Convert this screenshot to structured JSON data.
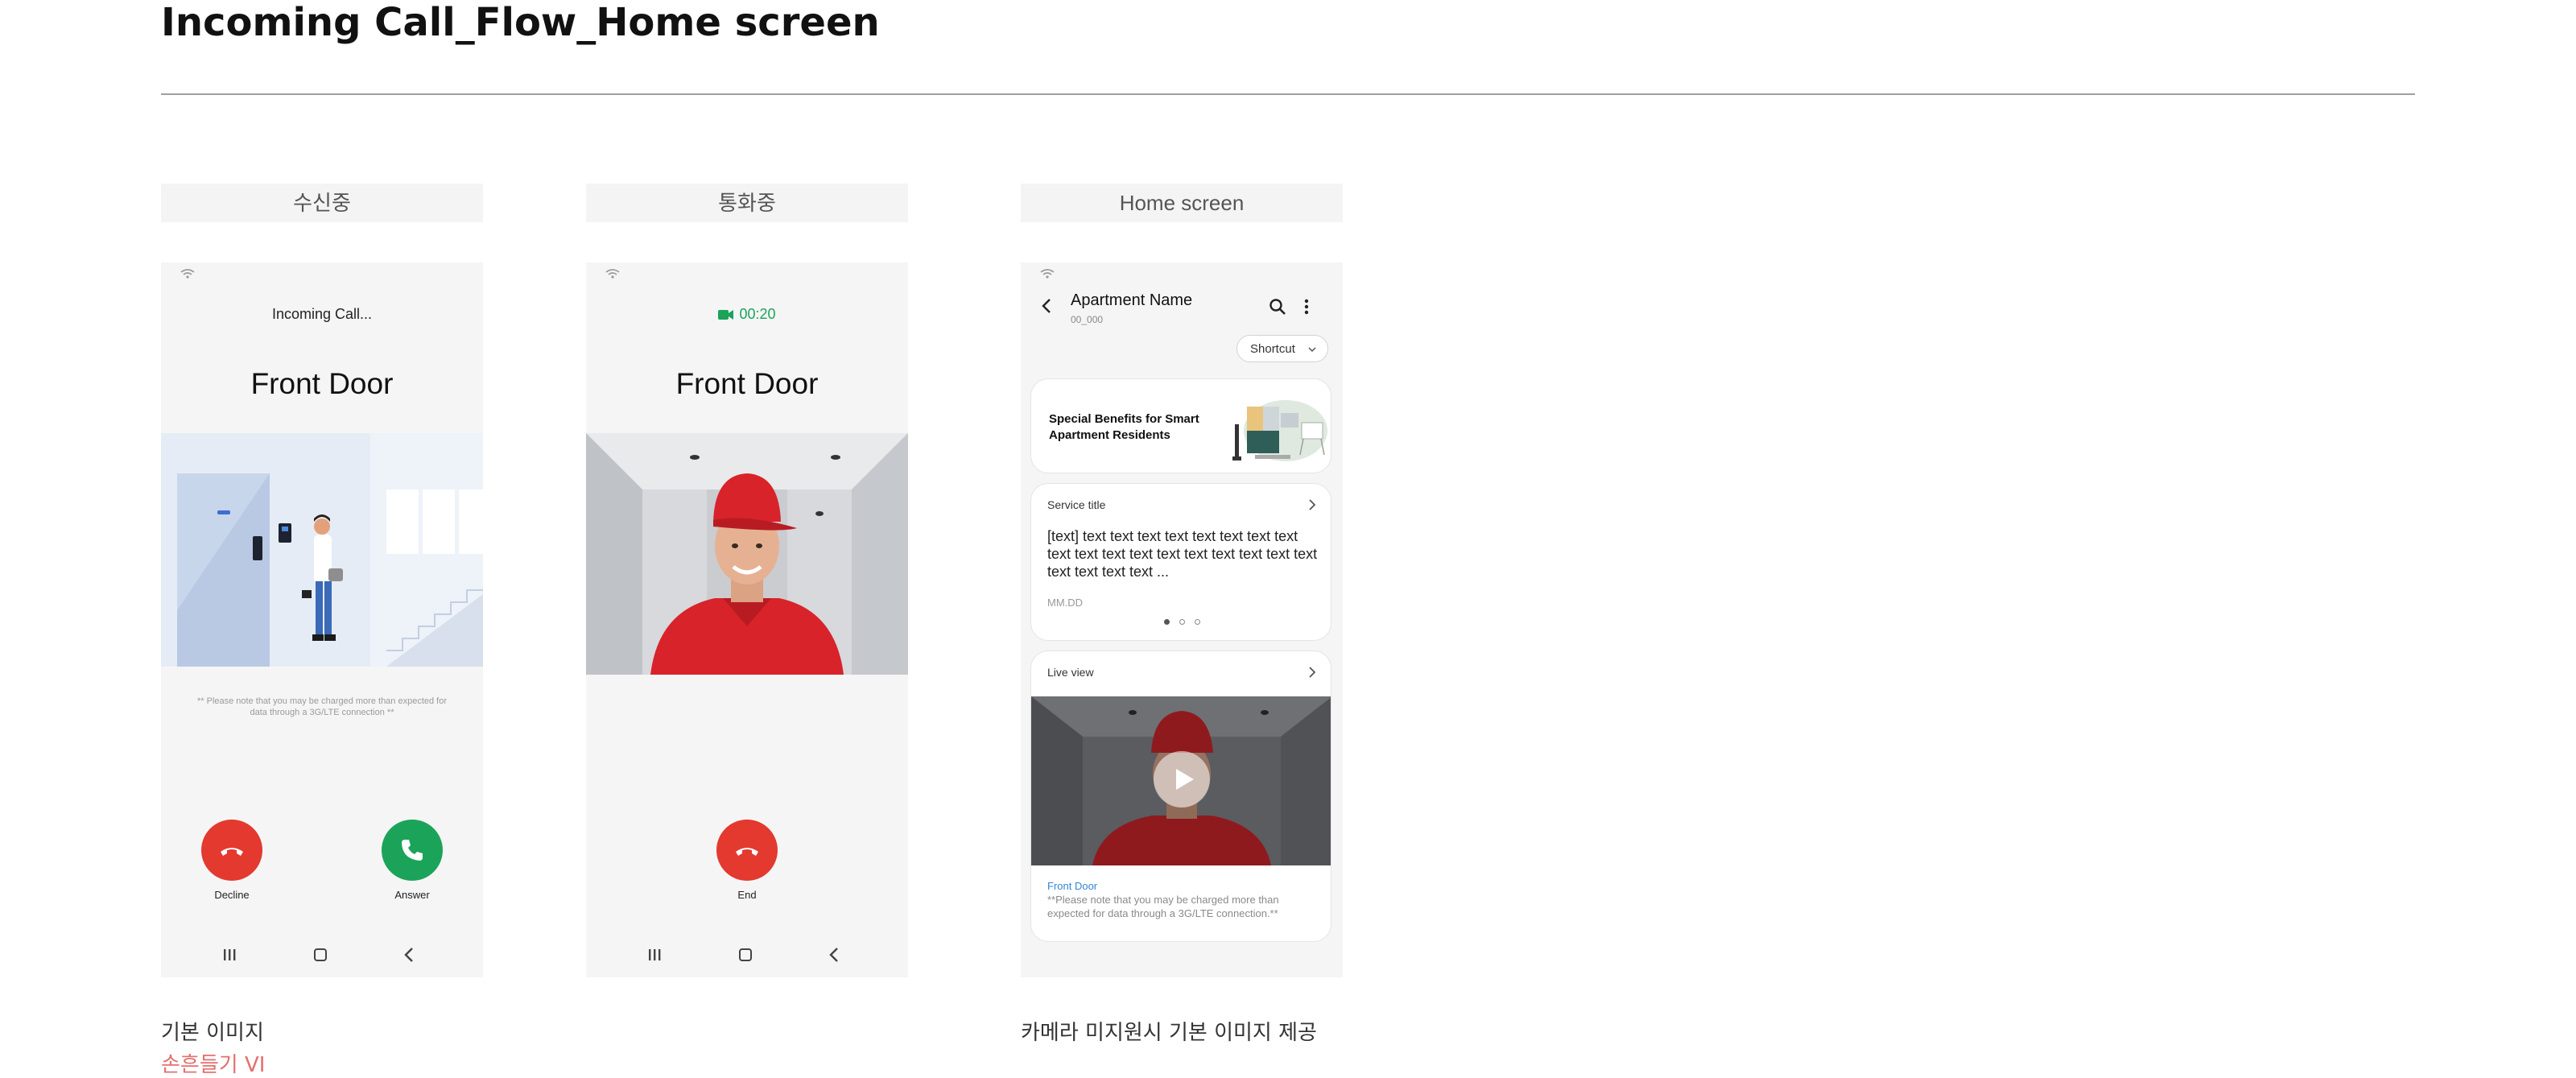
{
  "page": {
    "title": "Incoming Call_Flow_Home screen",
    "columns": [
      "수신중",
      "통화중",
      "Home screen"
    ]
  },
  "incoming": {
    "status": "Incoming Call...",
    "caller": "Front Door",
    "note": "** Please note that you may be charged more than expected for data through a 3G/LTE connection **",
    "decline_label": "Decline",
    "answer_label": "Answer"
  },
  "in_call": {
    "timer": "00:20",
    "caller": "Front Door",
    "end_label": "End"
  },
  "home": {
    "title": "Apartment Name",
    "subtitle": "00_000",
    "shortcut_label": "Shortcut",
    "benefit_text": "Special Benefits for Smart Apartment Residents",
    "service": {
      "title": "Service title",
      "body": "[text] text text text text text text text text text text text text text text text text text text text text text text ...",
      "date": "MM.DD"
    },
    "live": {
      "title": "Live view",
      "name": "Front Door",
      "note": "**Please note that you may be charged more than expected for data through a 3G/LTE connection.**"
    }
  },
  "captions": {
    "col1": "기본 이미지",
    "col1_accent": "손흔들기 VI",
    "col3": "카메라 미지원시 기본 이미지 제공"
  },
  "colors": {
    "decline": "#e3392f",
    "answer": "#1ba35a",
    "timer": "#1ba35a",
    "link": "#2f86d6",
    "accent_caption": "#e56f6f"
  }
}
